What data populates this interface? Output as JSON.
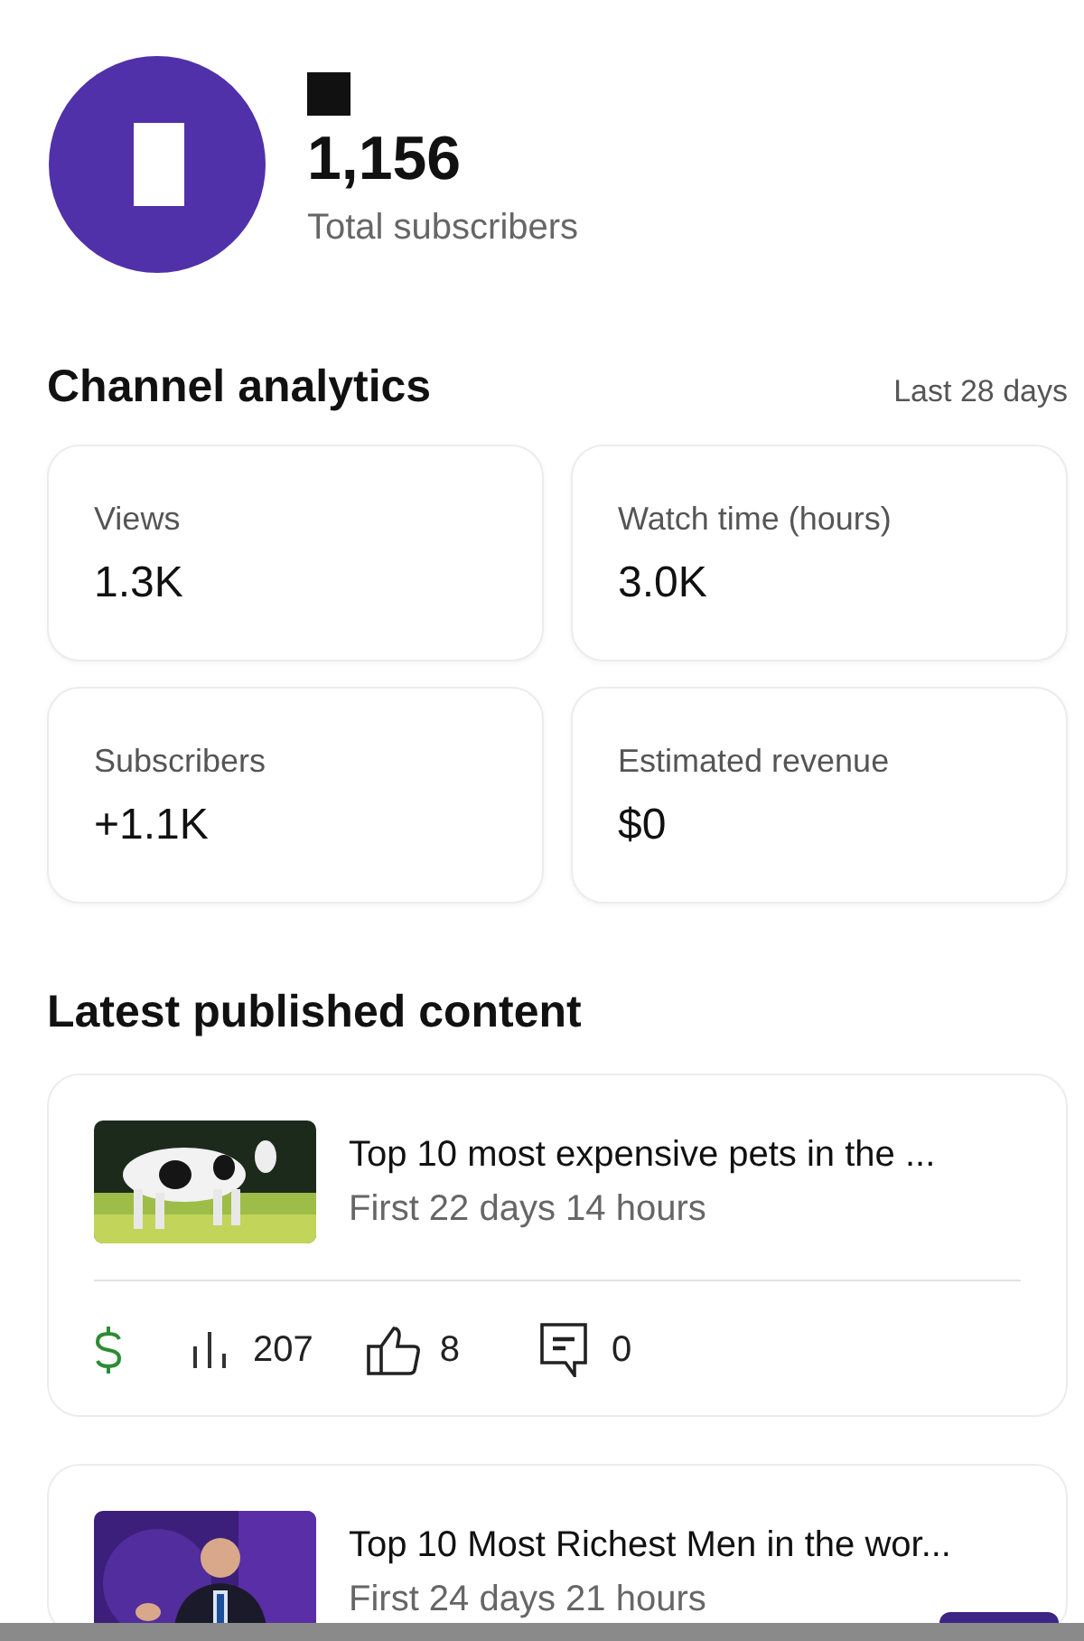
{
  "channel": {
    "subscriber_count": "1,156",
    "subscriber_label": "Total subscribers"
  },
  "analytics": {
    "title": "Channel analytics",
    "period": "Last 28 days",
    "metrics": [
      {
        "label": "Views",
        "value": "1.3K"
      },
      {
        "label": "Watch time (hours)",
        "value": "3.0K"
      },
      {
        "label": "Subscribers",
        "value": "+1.1K"
      },
      {
        "label": "Estimated revenue",
        "value": "$0"
      }
    ]
  },
  "latest": {
    "title": "Latest published content",
    "items": [
      {
        "kind": "picture",
        "title": "Top 10 most expensive pets in the ...",
        "period": "First 22 days 14 hours",
        "views": "207",
        "likes": "8",
        "comments": "0",
        "monetized": true
      },
      {
        "kind": "picture",
        "title": "Top 10 Most Richest Men in the wor...",
        "period": "First 24 days 21 hours"
      }
    ]
  }
}
